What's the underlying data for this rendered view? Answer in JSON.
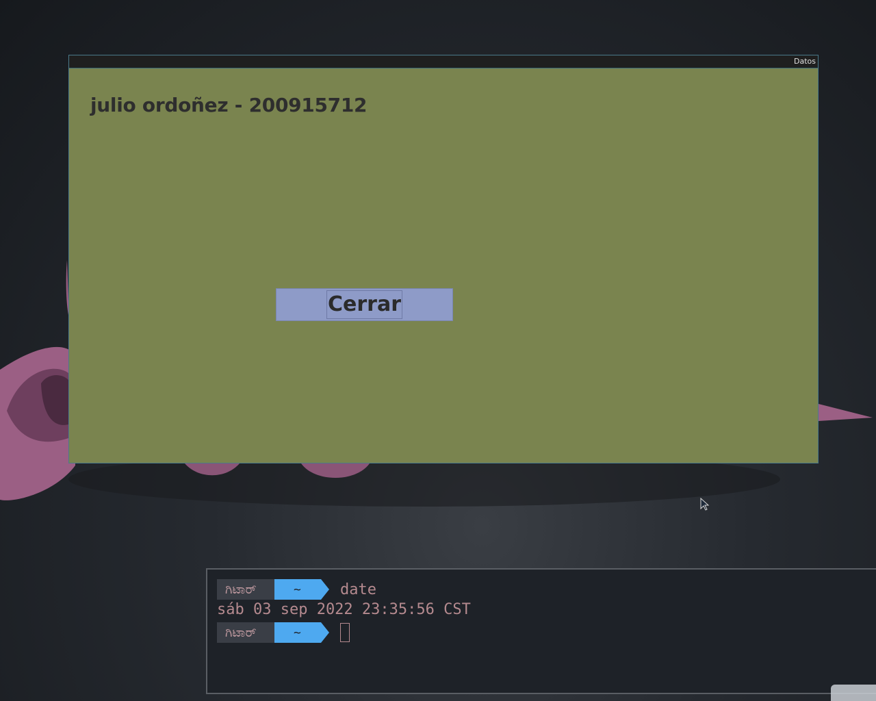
{
  "window": {
    "title": "Datos",
    "heading": "julio ordoñez - 200915712",
    "close_button_label": "Cerrar"
  },
  "terminal": {
    "prompt_user": "ಗಿಟಾರ್",
    "prompt_dir": "~",
    "command": "date",
    "output": "sáb 03 sep 2022 23:35:56 CST"
  },
  "colors": {
    "window_bg": "#7a844f",
    "button_bg": "#8e9bc8",
    "prompt_accent": "#4ea9f0",
    "terminal_text": "#b58a8f"
  },
  "icons": {
    "cursor": "mouse-pointer-icon"
  }
}
